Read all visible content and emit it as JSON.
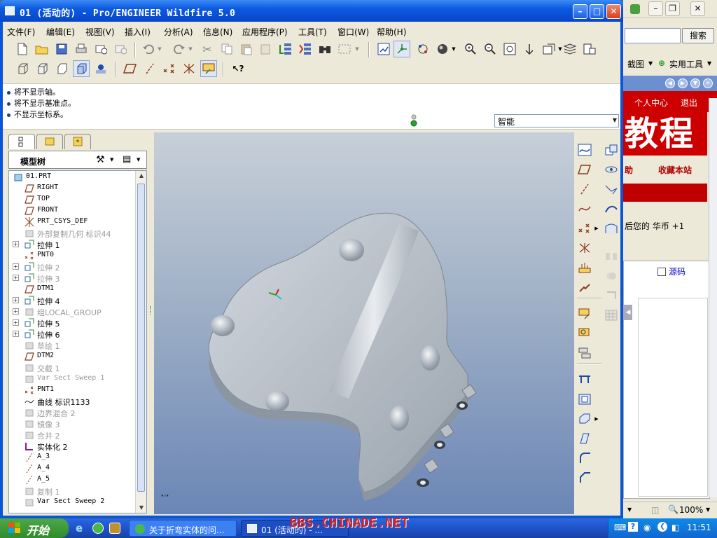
{
  "window": {
    "title": "01 (活动的) - Pro/ENGINEER Wildfire 5.0"
  },
  "menu": [
    "文件(F)",
    "编辑(E)",
    "视图(V)",
    "插入(I)",
    "分析(A)",
    "信息(N)",
    "应用程序(P)",
    "工具(T)",
    "窗口(W)",
    "帮助(H)"
  ],
  "messages": [
    "将不显示轴。",
    "将不显示基准点。",
    "不显示坐标系。"
  ],
  "filter": {
    "selected": "智能"
  },
  "model_tree": {
    "header": "模型树",
    "items": [
      {
        "label": "01.PRT",
        "expand": false,
        "dim": false
      },
      {
        "label": "RIGHT",
        "expand": false,
        "dim": false
      },
      {
        "label": "TOP",
        "expand": false,
        "dim": false
      },
      {
        "label": "FRONT",
        "expand": false,
        "dim": false
      },
      {
        "label": "PRT_CSYS_DEF",
        "expand": false,
        "dim": false
      },
      {
        "label": "外部复制几何 标识44",
        "expand": false,
        "dim": true
      },
      {
        "label": "拉伸 1",
        "expand": true,
        "dim": false
      },
      {
        "label": "PNT0",
        "expand": false,
        "dim": false
      },
      {
        "label": "拉伸 2",
        "expand": true,
        "dim": true
      },
      {
        "label": "拉伸 3",
        "expand": true,
        "dim": true
      },
      {
        "label": "DTM1",
        "expand": false,
        "dim": false
      },
      {
        "label": "拉伸 4",
        "expand": true,
        "dim": false
      },
      {
        "label": "组LOCAL_GROUP",
        "expand": true,
        "dim": true
      },
      {
        "label": "拉伸 5",
        "expand": true,
        "dim": false
      },
      {
        "label": "拉伸 6",
        "expand": true,
        "dim": false
      },
      {
        "label": "草绘 1",
        "expand": false,
        "dim": true
      },
      {
        "label": "DTM2",
        "expand": false,
        "dim": false
      },
      {
        "label": "交截 1",
        "expand": false,
        "dim": true
      },
      {
        "label": "Var Sect Sweep 1",
        "expand": false,
        "dim": true
      },
      {
        "label": "PNT1",
        "expand": false,
        "dim": false
      },
      {
        "label": "曲线 标识1133",
        "expand": false,
        "dim": false
      },
      {
        "label": "边界混合 2",
        "expand": false,
        "dim": true
      },
      {
        "label": "镜像 3",
        "expand": false,
        "dim": true
      },
      {
        "label": "合并 2",
        "expand": false,
        "dim": true
      },
      {
        "label": "实体化 2",
        "expand": false,
        "dim": false
      },
      {
        "label": "A_3",
        "expand": false,
        "dim": false
      },
      {
        "label": "A_4",
        "expand": false,
        "dim": false
      },
      {
        "label": "A_5",
        "expand": false,
        "dim": false
      },
      {
        "label": "复制 1",
        "expand": false,
        "dim": true
      },
      {
        "label": "Var Sect Sweep 2",
        "expand": false,
        "dim": false
      }
    ]
  },
  "browser": {
    "search_button": "搜索",
    "tools": [
      "截图",
      "实用工具"
    ],
    "nav": [
      "个人中心",
      "退出"
    ],
    "banner": "教程",
    "links": [
      "助",
      "收藏本站"
    ],
    "notice": "后您的 华币 +1",
    "source": "源码",
    "zoom": "100%"
  },
  "taskbar": {
    "start": "开始",
    "tasks": [
      "关于折弯实体的问...",
      "01 (活动的) - ..."
    ],
    "clock": "11:51"
  },
  "watermark": "BBS.CHINADE.NET",
  "colors": {
    "titlebar": "#0b5ae0",
    "viewport_top": "#c7cfd8",
    "viewport_bottom": "#6b86b6",
    "part": "#b9bfc7"
  }
}
